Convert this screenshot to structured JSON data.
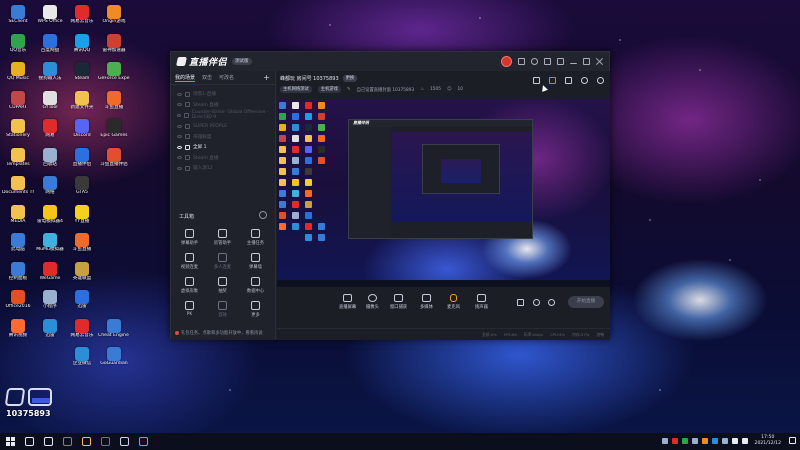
{
  "desktop": {
    "icons": [
      {
        "label": "SEClient",
        "color": "#3a7bd5"
      },
      {
        "label": "WPS Office",
        "color": "#e8e8e8"
      },
      {
        "label": "网易云音乐",
        "color": "#e02b2b"
      },
      {
        "label": "Origin游戏",
        "color": "#f08a24"
      },
      {
        "label": "",
        "color": ""
      },
      {
        "label": "QQ音乐",
        "color": "#2ca54c"
      },
      {
        "label": "百度网盘",
        "color": "#2b6fe0"
      },
      {
        "label": "腾讯QQ",
        "color": "#1aa0e8"
      },
      {
        "label": "雷神加速器",
        "color": "#d04030"
      },
      {
        "label": "",
        "color": ""
      },
      {
        "label": "QQ Music",
        "color": "#e8b020"
      },
      {
        "label": "搜狗输入法",
        "color": "#2b8fd8"
      },
      {
        "label": "Steam",
        "color": "#1b2838"
      },
      {
        "label": "GeForce Experience",
        "color": "#4caf50"
      },
      {
        "label": "",
        "color": ""
      },
      {
        "label": "CUPART",
        "color": "#c04848"
      },
      {
        "label": "GYTool",
        "color": "#e0e0e0"
      },
      {
        "label": "新建文件夹",
        "color": "#f2c14e"
      },
      {
        "label": "斗鱼直播",
        "color": "#f06a2a"
      },
      {
        "label": "",
        "color": ""
      },
      {
        "label": "Stationery",
        "color": "#f2c14e"
      },
      {
        "label": "网易",
        "color": "#e02b2b"
      },
      {
        "label": "Discord",
        "color": "#5865f2"
      },
      {
        "label": "Epic Games",
        "color": "#2a2a2a"
      },
      {
        "label": "",
        "color": ""
      },
      {
        "label": "Templates",
        "color": "#f2c14e"
      },
      {
        "label": "回收站",
        "color": "#9ab0d0"
      },
      {
        "label": "直播伴侣",
        "color": "#2b6fe0"
      },
      {
        "label": "斗鱼直播伴侣",
        "color": "#e05030"
      },
      {
        "label": "",
        "color": ""
      },
      {
        "label": "Documents Themes 14",
        "color": "#f2c14e"
      },
      {
        "label": "网络",
        "color": "#3a7bd5"
      },
      {
        "label": "GTA5",
        "color": "#3a3a3a"
      },
      {
        "label": "",
        "color": ""
      },
      {
        "label": "",
        "color": ""
      },
      {
        "label": "MEDIA",
        "color": "#f2c14e"
      },
      {
        "label": "雷电模拟器4",
        "color": "#f5c518"
      },
      {
        "label": "YY直播",
        "color": "#f5d020"
      },
      {
        "label": "",
        "color": ""
      },
      {
        "label": "",
        "color": ""
      },
      {
        "label": "此电脑",
        "color": "#3a7bd5"
      },
      {
        "label": "MuMu模拟器",
        "color": "#3fb0e0"
      },
      {
        "label": "斗鱼直播",
        "color": "#f06a2a"
      },
      {
        "label": "",
        "color": ""
      },
      {
        "label": "",
        "color": ""
      },
      {
        "label": "控制面板",
        "color": "#3a7bd5"
      },
      {
        "label": "WeGame",
        "color": "#e02b2b"
      },
      {
        "label": "英雄联盟",
        "color": "#c8a040"
      },
      {
        "label": "",
        "color": ""
      },
      {
        "label": "",
        "color": ""
      },
      {
        "label": "Office2016",
        "color": "#e05020"
      },
      {
        "label": "小程序",
        "color": "#9ab0d0"
      },
      {
        "label": "迅雷",
        "color": "#2b6fe0"
      },
      {
        "label": "",
        "color": ""
      },
      {
        "label": "",
        "color": ""
      },
      {
        "label": "腾讯视频",
        "color": "#ff6a30"
      },
      {
        "label": "迅雷",
        "color": "#2b8fd8"
      },
      {
        "label": "网易云音乐",
        "color": "#e02b2b"
      },
      {
        "label": "Cheat Engine 7.2",
        "color": "#3a7bd5"
      },
      {
        "label": "",
        "color": ""
      },
      {
        "label": "",
        "color": ""
      },
      {
        "label": "",
        "color": ""
      },
      {
        "label": "企业微信",
        "color": "#2b8fd8"
      },
      {
        "label": "GoGuardian",
        "color": "#3a7bd5"
      },
      {
        "label": "",
        "color": ""
      }
    ]
  },
  "app": {
    "name": "直播伴侣",
    "version_badge": "测试版",
    "left_tabs": [
      "我的场景",
      "双击",
      "可改名"
    ],
    "add_tab": "+",
    "scenes": [
      {
        "label": "场景1-直播",
        "active": false
      },
      {
        "label": "Steam 直播",
        "active": false
      },
      {
        "label": "Counter-Strike: Global Offensive - Direct3D 9",
        "active": false
      },
      {
        "label": "SUPER PEOPLE",
        "active": false
      },
      {
        "label": "英雄联盟",
        "active": false
      },
      {
        "label": "全屏 1",
        "active": true
      },
      {
        "label": "Steam 直播",
        "active": false
      },
      {
        "label": "输入源12",
        "active": false
      }
    ],
    "toolbox_label": "工具箱",
    "tools": [
      {
        "label": "弹幕助手",
        "dim": false
      },
      {
        "label": "房管助手",
        "dim": false
      },
      {
        "label": "主播任务",
        "dim": false
      },
      {
        "label": "视频连麦",
        "dim": false
      },
      {
        "label": "多人连麦",
        "dim": true
      },
      {
        "label": "弹幕墙",
        "dim": false
      },
      {
        "label": "虚拟形象",
        "dim": false
      },
      {
        "label": "抽奖",
        "dim": false
      },
      {
        "label": "数据中心",
        "dim": false
      },
      {
        "label": "PK",
        "dim": false
      },
      {
        "label": "音效",
        "dim": true
      },
      {
        "label": "更多",
        "dim": false
      }
    ],
    "left_footer": "礼包任务、点歌和多功能开放中，看看再说",
    "room": {
      "name": "峰都玩 房间号 10375893",
      "badge": "更换",
      "tags": [
        "主机网络测试",
        "主机游戏"
      ],
      "subtitle": "自己设置直播封面 10375893",
      "count1": "1505",
      "count2": "10"
    },
    "controls": [
      {
        "label": "直播屏幕",
        "type": "box"
      },
      {
        "label": "摄像头",
        "type": "round"
      },
      {
        "label": "窗口捕获",
        "type": "box"
      },
      {
        "label": "多媒体",
        "type": "box"
      },
      {
        "label": "麦克风",
        "type": "mic"
      },
      {
        "label": "扬声器",
        "type": "box"
      }
    ],
    "start_button": "开始直播",
    "status_items": [
      "丢帧:0%",
      "FPS:60",
      "码率:0kb/s",
      "CPU:4%",
      "内存:27%",
      "流畅"
    ]
  },
  "watermark": {
    "room_number": "10375893"
  },
  "taskbar": {
    "time": "17:50",
    "date": "2021/12/12",
    "pinned": [
      {
        "name": "search-icon",
        "color": "#e8ecf5"
      },
      {
        "name": "task-view-icon",
        "color": "#e8ecf5"
      },
      {
        "name": "edge-icon",
        "color": "#2b9fe0"
      },
      {
        "name": "file-explorer-icon",
        "color": "#f2c14e"
      },
      {
        "name": "chrome-icon",
        "color": "#e04a3f"
      },
      {
        "name": "steam-icon",
        "color": "#c7d5e0"
      },
      {
        "name": "app-icon",
        "color": "#f08a24"
      }
    ],
    "tray_colors": [
      "#9ab0d0",
      "#e02b2b",
      "#2ca54c",
      "#9ab0d0",
      "#f08a24",
      "#2b8fd8",
      "#9ab0d0",
      "#e8ecf5",
      "#e8ecf5"
    ]
  }
}
